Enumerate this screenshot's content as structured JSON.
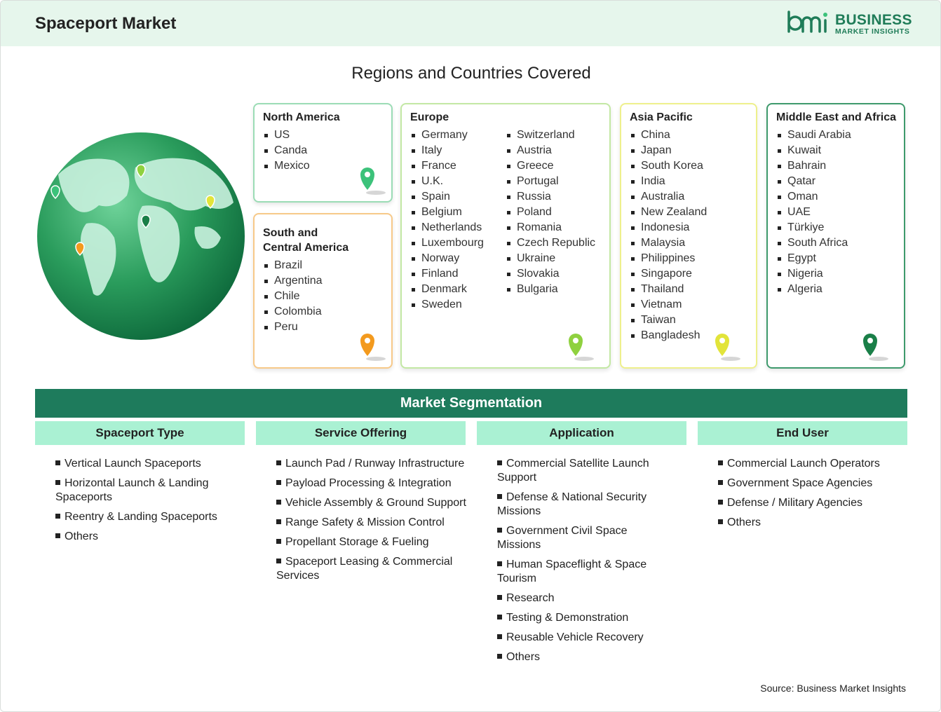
{
  "header": {
    "title": "Spaceport Market"
  },
  "logo": {
    "brand": "BUSINESS",
    "sub": "MARKET INSIGHTS"
  },
  "regions_title": "Regions and Countries Covered",
  "regions": {
    "north_america": {
      "title": "North America",
      "items": [
        "US",
        "Canda",
        "Mexico"
      ]
    },
    "south_central_america": {
      "title_line1": "South and",
      "title_line2": "Central America",
      "items": [
        "Brazil",
        "Argentina",
        "Chile",
        "Colombia",
        "Peru"
      ]
    },
    "europe": {
      "title": "Europe",
      "col1": [
        "Germany",
        "Italy",
        "France",
        "U.K.",
        "Spain",
        "Belgium",
        "Netherlands",
        "Luxembourg",
        "Norway",
        "Finland",
        "Denmark",
        "Sweden"
      ],
      "col2": [
        "Switzerland",
        "Austria",
        "Greece",
        "Portugal",
        "Russia",
        "Poland",
        "Romania",
        "Czech Republic",
        "Ukraine",
        "Slovakia",
        "Bulgaria"
      ]
    },
    "asia_pacific": {
      "title": "Asia Pacific",
      "items": [
        "China",
        "Japan",
        "South Korea",
        "India",
        "Australia",
        "New Zealand",
        "Indonesia",
        "Malaysia",
        "Philippines",
        "Singapore",
        "Thailand",
        "Vietnam",
        "Taiwan",
        "Bangladesh"
      ]
    },
    "middle_east_africa": {
      "title": "Middle East and Africa",
      "items": [
        "Saudi Arabia",
        "Kuwait",
        "Bahrain",
        "Qatar",
        "Oman",
        "UAE",
        "Türkiye",
        "South Africa",
        "Egypt",
        "Nigeria",
        "Algeria"
      ]
    }
  },
  "pin_colors": {
    "north_america": "#3cc27a",
    "south_central_america": "#f39a1e",
    "europe": "#8fd13f",
    "asia_pacific": "#e2e43a",
    "middle_east_africa": "#1a7f48"
  },
  "segmentation": {
    "title": "Market Segmentation",
    "columns": [
      {
        "header": "Spaceport Type",
        "items": [
          "Vertical Launch Spaceports",
          "Horizontal Launch & Landing Spaceports",
          "Reentry & Landing Spaceports",
          "Others"
        ]
      },
      {
        "header": "Service Offering",
        "items": [
          "Launch Pad / Runway Infrastructure",
          "Payload Processing & Integration",
          "Vehicle Assembly & Ground Support",
          "Range Safety & Mission Control",
          "Propellant Storage & Fueling",
          "Spaceport Leasing & Commercial Services"
        ]
      },
      {
        "header": "Application",
        "items": [
          "Commercial Satellite Launch Support",
          "Defense & National Security Missions",
          "Government Civil Space Missions",
          "Human Spaceflight & Space Tourism",
          "Research",
          "Testing & Demonstration",
          "Reusable Vehicle Recovery",
          "Others"
        ]
      },
      {
        "header": "End User",
        "items": [
          "Commercial Launch Operators",
          "Government Space Agencies",
          "Defense / Military Agencies",
          "Others"
        ]
      }
    ]
  },
  "source": "Source: Business Market Insights"
}
